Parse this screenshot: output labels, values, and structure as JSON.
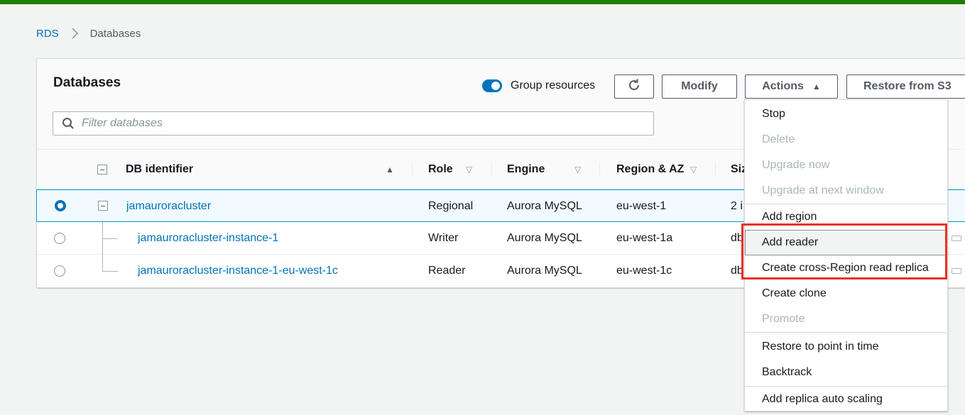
{
  "breadcrumb": {
    "root": "RDS",
    "current": "Databases"
  },
  "panel": {
    "title": "Databases",
    "group_resources_label": "Group resources",
    "group_resources_on": true,
    "buttons": {
      "modify": "Modify",
      "actions": "Actions",
      "restore": "Restore from S3"
    },
    "filter_placeholder": "Filter databases"
  },
  "table": {
    "columns": {
      "db_identifier": "DB identifier",
      "role": "Role",
      "engine": "Engine",
      "region": "Region & AZ",
      "size": "Siz"
    },
    "rows": [
      {
        "id": "jamauroracluster",
        "role": "Regional",
        "engine": "Aurora MySQL",
        "region": "eu-west-1",
        "size": "2 i",
        "selected": true
      },
      {
        "id": "jamauroracluster-instance-1",
        "role": "Writer",
        "engine": "Aurora MySQL",
        "region": "eu-west-1a",
        "size": "db",
        "selected": false
      },
      {
        "id": "jamauroracluster-instance-1-eu-west-1c",
        "role": "Reader",
        "engine": "Aurora MySQL",
        "region": "eu-west-1c",
        "size": "db",
        "selected": false
      }
    ]
  },
  "actions_menu": {
    "items": [
      {
        "label": "Stop",
        "disabled": false
      },
      {
        "label": "Delete",
        "disabled": true
      },
      {
        "label": "Upgrade now",
        "disabled": true
      },
      {
        "label": "Upgrade at next window",
        "disabled": true
      },
      {
        "label": "Add region",
        "disabled": false
      },
      {
        "label": "Add reader",
        "disabled": false,
        "hovered": true
      },
      {
        "label": "Create cross-Region read replica",
        "disabled": false
      },
      {
        "label": "Create clone",
        "disabled": false
      },
      {
        "label": "Promote",
        "disabled": true
      },
      {
        "label": "Restore to point in time",
        "disabled": false
      },
      {
        "label": "Backtrack",
        "disabled": false
      },
      {
        "label": "Add replica auto scaling",
        "disabled": false
      }
    ]
  },
  "colors": {
    "accent": "#0073bb",
    "topbar": "#1d8102",
    "highlight": "#e8321f",
    "disabled": "#aab7b8"
  },
  "icons": {
    "refresh": "refresh-icon",
    "search": "search-icon",
    "breadcrumb_sep": "chevron-right-icon"
  }
}
